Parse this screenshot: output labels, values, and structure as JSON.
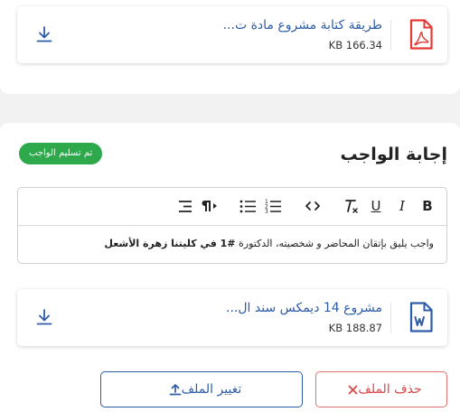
{
  "attachment": {
    "name": "طريقة كتابة مشروع مادة ت...",
    "size": "KB 166.34",
    "type_icon": "pdf-icon"
  },
  "answer": {
    "title": "إجابة الواجب",
    "status_badge": "تم تسليم الواجب",
    "editor": {
      "text_plain": "واجب يليق بإتقان المحاضر و شخصيته، الدكتورة ",
      "text_bold": "#1 في كليتنا زهرة الأشعل"
    },
    "file": {
      "name": "مشروع 14 ديمكس سند ال...",
      "size": "KB 188.87",
      "type_icon": "word-icon"
    },
    "buttons": {
      "delete_label": "حذف الملف",
      "change_label": "تغيير الملف"
    }
  },
  "colors": {
    "link": "#2d5ca8",
    "pdf": "#e53935",
    "success": "#2da84b",
    "danger": "#d94848"
  }
}
